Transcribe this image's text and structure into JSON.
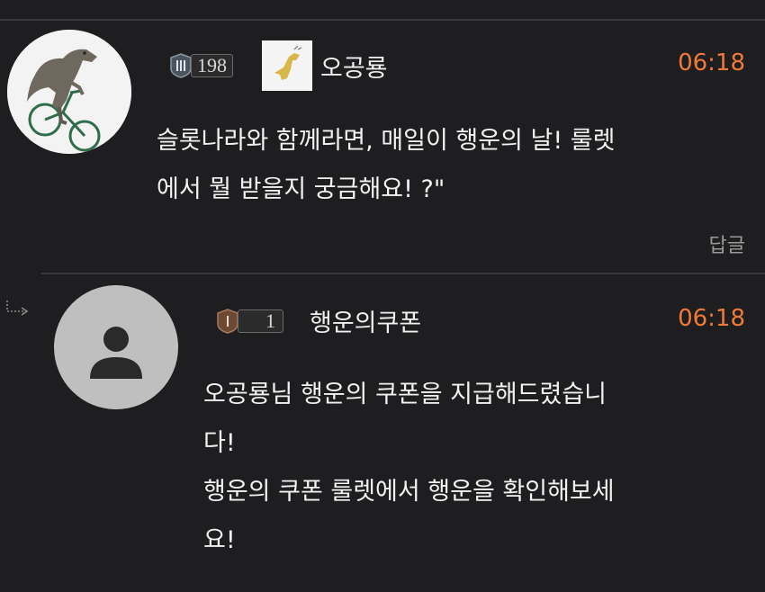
{
  "comments": [
    {
      "level": "198",
      "username": "오공룡",
      "time": "06:18",
      "lines": [
        "슬롯나라와 함께라면, 매일이 행운의 날! 룰렛",
        "에서 뭘 받을지 궁금해요! ?\""
      ],
      "reply_label": "답글"
    }
  ],
  "replies": [
    {
      "level": "1",
      "username": "행운의쿠폰",
      "time": "06:18",
      "lines": [
        "오공룡님 행운의 쿠폰을 지급해드렸습니",
        "다!",
        "행운의 쿠폰 룰렛에서 행운을 확인해보세",
        "요!"
      ]
    }
  ],
  "colors": {
    "background": "#1e1e20",
    "time": "#f07a36",
    "divider": "#3a3a3d"
  },
  "icons": {
    "reply_arrow": "reply-arrow-icon",
    "default_avatar": "person-icon"
  }
}
